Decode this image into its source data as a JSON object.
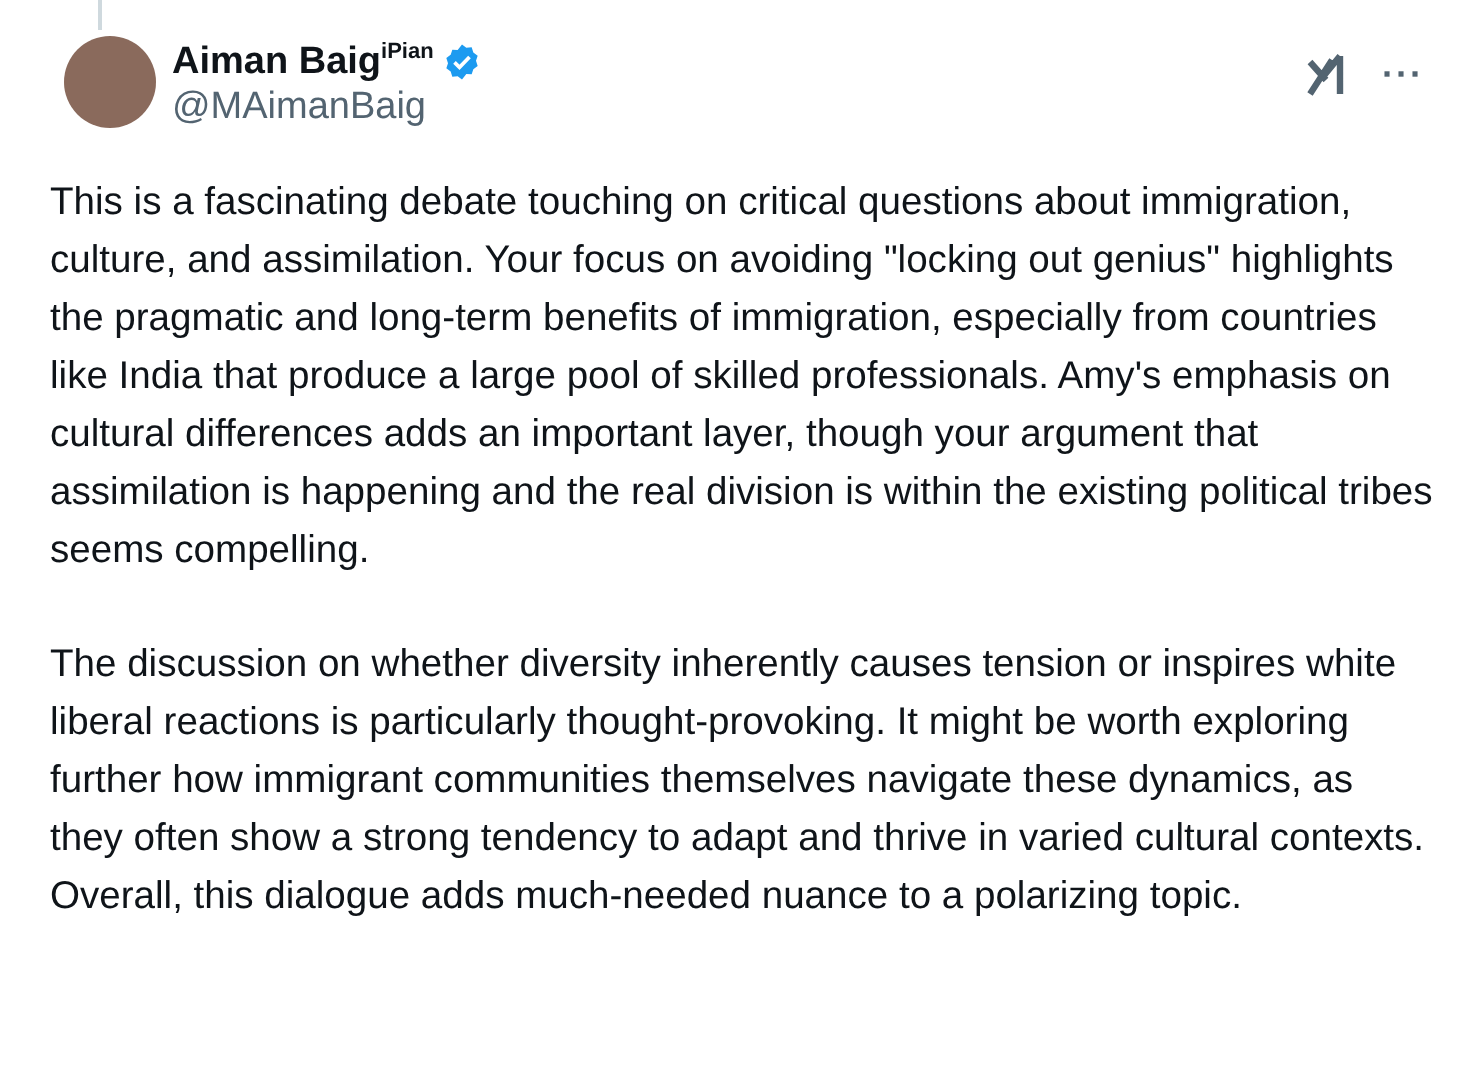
{
  "author": {
    "name": "Aiman Baig$^{iPian}$",
    "verified": true,
    "handle": "@MAimanBaig"
  },
  "menu_icon": "···",
  "paragraphs": [
    "This is a fascinating debate touching on critical questions about immigration, culture, and assimilation. Your focus on avoiding \"locking out genius\" highlights the pragmatic and long-term benefits of immigration, especially from countries like India that produce a large pool of skilled professionals. Amy's emphasis on cultural differences adds an important layer, though your argument that assimilation is happening and the real division is within the existing political tribes seems compelling.",
    "The discussion on whether diversity inherently causes tension or inspires white liberal reactions is particularly thought-provoking. It might be worth exploring further how immigrant communities themselves navigate these dynamics, as they often show a strong tendency to adapt and thrive in varied cultural contexts. Overall, this dialogue adds much-needed nuance to a polarizing topic."
  ]
}
